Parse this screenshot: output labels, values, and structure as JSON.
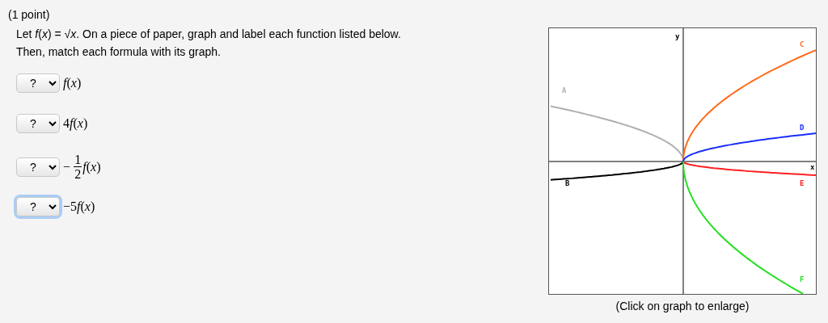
{
  "points": "(1 point)",
  "instructions": [
    "Let *f*(*x*) = √*x*. On a piece of paper, graph and label each function listed below.",
    "Then, match each formula with its graph."
  ],
  "items": [
    {
      "answer": "?",
      "focused": false,
      "kind": "plain",
      "formula": "*f*(*x*)"
    },
    {
      "answer": "?",
      "focused": false,
      "kind": "plain",
      "coefficient": "4",
      "formula": "*f*(*x*)"
    },
    {
      "answer": "?",
      "focused": false,
      "kind": "fraction",
      "sign": "−",
      "numerator": "1",
      "denominator": "2",
      "formula": "*f*(*x*)"
    },
    {
      "answer": "?",
      "focused": true,
      "kind": "plain",
      "coefficient": "−5",
      "formula": "*f*(*x*)"
    }
  ],
  "graph": {
    "y_label": "y",
    "x_label": "x",
    "curves": [
      {
        "label": "A",
        "color": "#b0b0b0"
      },
      {
        "label": "B",
        "color": "#000000"
      },
      {
        "label": "C",
        "color": "#ff6a1a"
      },
      {
        "label": "D",
        "color": "#1a2eff"
      },
      {
        "label": "E",
        "color": "#ff2020"
      },
      {
        "label": "F",
        "color": "#22e022"
      }
    ],
    "caption": "(Click on graph to enlarge)"
  }
}
